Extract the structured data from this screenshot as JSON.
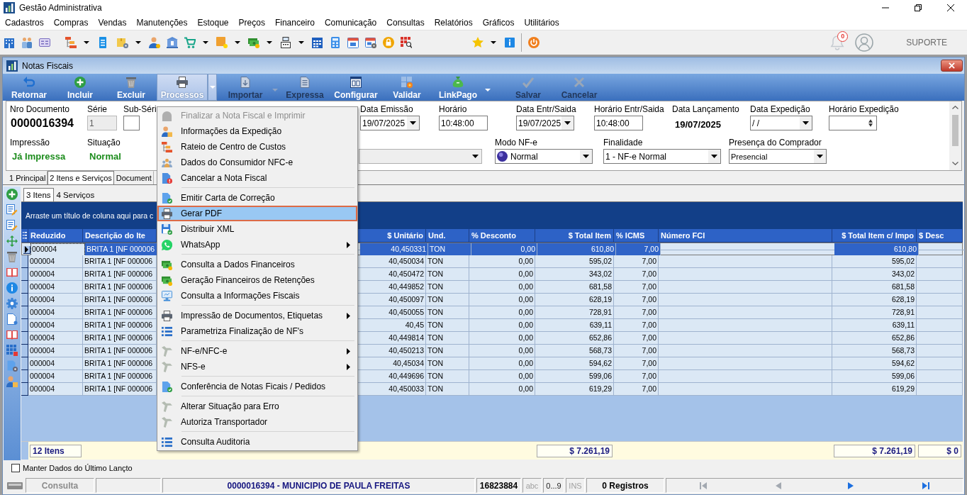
{
  "window": {
    "title": "Gestão Administrativa"
  },
  "menu_bar": [
    "Cadastros",
    "Compras",
    "Vendas",
    "Manutenções",
    "Estoque",
    "Preços",
    "Financeiro",
    "Comunicação",
    "Consultas",
    "Relatórios",
    "Gráficos",
    "Utilitários"
  ],
  "toolbar": {
    "notification_count": "0",
    "user": "SUPORTE"
  },
  "document_window": {
    "title": "Notas Fiscais"
  },
  "actions": [
    {
      "label": "Retornar",
      "selected": false,
      "disabled": false,
      "dropdown": false
    },
    {
      "label": "Incluir",
      "selected": false,
      "disabled": false,
      "dropdown": false
    },
    {
      "label": "Excluir",
      "selected": false,
      "disabled": false,
      "dropdown": false
    },
    {
      "label": "Processos",
      "selected": true,
      "disabled": false,
      "dropdown": true
    },
    {
      "label": "Importar",
      "selected": false,
      "disabled": true,
      "dropdown": true
    },
    {
      "label": "Expressa",
      "selected": false,
      "disabled": true,
      "dropdown": false
    },
    {
      "label": "Configurar",
      "selected": false,
      "disabled": false,
      "dropdown": false
    },
    {
      "label": "Validar",
      "selected": false,
      "disabled": false,
      "dropdown": false
    },
    {
      "label": "LinkPago",
      "selected": false,
      "disabled": false,
      "dropdown": true
    },
    {
      "label": "Salvar",
      "selected": false,
      "disabled": true,
      "dropdown": false
    },
    {
      "label": "Cancelar",
      "selected": false,
      "disabled": true,
      "dropdown": false
    }
  ],
  "form": {
    "row_1": [
      {
        "kind": "display",
        "label": "Nro Documento",
        "value": "0000016394",
        "disabled": false
      },
      {
        "kind": "input",
        "label": "Série",
        "value": "1",
        "disabled": true
      },
      {
        "kind": "input",
        "label": "Sub-Séri",
        "disabled": false
      },
      {
        "kind": "select",
        "label": "Data Emissão",
        "value": "19/07/2025",
        "disabled": false
      },
      {
        "kind": "input",
        "label": "Horário",
        "value": "10:48:00",
        "disabled": false
      },
      {
        "kind": "select",
        "label": "Data Entr/Saida",
        "value": "19/07/2025",
        "disabled": false
      },
      {
        "kind": "input",
        "label": "Horário Entr/Saida",
        "value": "10:48:00",
        "disabled": false
      },
      {
        "kind": "date",
        "label": "Data Lançamento",
        "value": "19/07/2025",
        "disabled": false
      },
      {
        "kind": "select",
        "label": "Data Expedição",
        "value": "/ /",
        "disabled": false
      },
      {
        "kind": "spin",
        "label": "Horário Expedição",
        "disabled": false
      }
    ],
    "row_2": [
      {
        "kind": "status",
        "label": "Impressão",
        "value": "Já Impressa",
        "disabled": false
      },
      {
        "kind": "status",
        "label": "Situação",
        "value": "Normal",
        "disabled": false
      },
      {
        "kind": "select",
        "disabled": true
      },
      {
        "kind": "iconselect",
        "label": "Modo NF-e",
        "value": "Normal",
        "disabled": false
      },
      {
        "kind": "select",
        "label": "Finalidade",
        "value": "1 - NF-e Normal",
        "disabled": false
      },
      {
        "kind": "select",
        "label": "Presença do Comprador",
        "value": "Presencial",
        "disabled": false
      }
    ]
  },
  "tabs": [
    {
      "label": "1 Principal",
      "selected": false
    },
    {
      "label": "2 Itens e Serviços",
      "selected": true
    },
    {
      "label": "Document",
      "selected": false
    }
  ],
  "subtabs": [
    {
      "label": "3 Itens",
      "selected": true
    },
    {
      "label": "4 Serviços",
      "selected": false
    }
  ],
  "grid": {
    "group_hint": "Arraste um título de coluna aqui para c",
    "columns": [
      "Reduzido",
      "Descrição do Ite",
      "$ Unitário",
      "Und.",
      "% Desconto",
      "$ Total Item",
      "% ICMS",
      "Número FCI",
      "$ Total Item c/ Impo",
      "$ Desc"
    ],
    "rows": [
      {
        "selected": true,
        "code": "000004",
        "description": "BRITA 1 [NF 000006",
        "unit_price": "40,450331",
        "unit": "TON",
        "discount": "0,00",
        "total": "610,80",
        "icms": "7,00",
        "total_with_taxes": "610,80"
      },
      {
        "selected": false,
        "code": "000004",
        "description": "BRITA 1 [NF 000006",
        "unit_price": "40,450034",
        "unit": "TON",
        "discount": "0,00",
        "total": "595,02",
        "icms": "7,00",
        "total_with_taxes": "595,02"
      },
      {
        "selected": false,
        "code": "000004",
        "description": "BRITA 1 [NF 000006",
        "unit_price": "40,450472",
        "unit": "TON",
        "discount": "0,00",
        "total": "343,02",
        "icms": "7,00",
        "total_with_taxes": "343,02"
      },
      {
        "selected": false,
        "code": "000004",
        "description": "BRITA 1 [NF 000006",
        "unit_price": "40,449852",
        "unit": "TON",
        "discount": "0,00",
        "total": "681,58",
        "icms": "7,00",
        "total_with_taxes": "681,58"
      },
      {
        "selected": false,
        "code": "000004",
        "description": "BRITA 1 [NF 000006",
        "unit_price": "40,450097",
        "unit": "TON",
        "discount": "0,00",
        "total": "628,19",
        "icms": "7,00",
        "total_with_taxes": "628,19"
      },
      {
        "selected": false,
        "code": "000004",
        "description": "BRITA 1 [NF 000006",
        "unit_price": "40,450055",
        "unit": "TON",
        "discount": "0,00",
        "total": "728,91",
        "icms": "7,00",
        "total_with_taxes": "728,91"
      },
      {
        "selected": false,
        "code": "000004",
        "description": "BRITA 1 [NF 000006",
        "unit_price": "40,45",
        "unit": "TON",
        "discount": "0,00",
        "total": "639,11",
        "icms": "7,00",
        "total_with_taxes": "639,11"
      },
      {
        "selected": false,
        "code": "000004",
        "description": "BRITA 1 [NF 000006",
        "unit_price": "40,449814",
        "unit": "TON",
        "discount": "0,00",
        "total": "652,86",
        "icms": "7,00",
        "total_with_taxes": "652,86"
      },
      {
        "selected": false,
        "code": "000004",
        "description": "BRITA 1 [NF 000006",
        "unit_price": "40,450213",
        "unit": "TON",
        "discount": "0,00",
        "total": "568,73",
        "icms": "7,00",
        "total_with_taxes": "568,73"
      },
      {
        "selected": false,
        "code": "000004",
        "description": "BRITA 1 [NF 000006",
        "unit_price": "40,45034",
        "unit": "TON",
        "discount": "0,00",
        "total": "594,62",
        "icms": "7,00",
        "total_with_taxes": "594,62"
      },
      {
        "selected": false,
        "code": "000004",
        "description": "BRITA 1 [NF 000006",
        "unit_price": "40,449696",
        "unit": "TON",
        "discount": "0,00",
        "total": "599,06",
        "icms": "7,00",
        "total_with_taxes": "599,06"
      },
      {
        "selected": false,
        "code": "000004",
        "description": "BRITA 1 [NF 000006",
        "unit_price": "40,450033",
        "unit": "TON",
        "discount": "0,00",
        "total": "619,29",
        "icms": "7,00",
        "total_with_taxes": "619,29"
      }
    ],
    "footer": {
      "item_count": "12 Itens",
      "total": "$ 7.261,19",
      "total_with_taxes": "$ 7.261,19",
      "discount_value": "$ 0"
    }
  },
  "keep_data": {
    "label": "Manter Dados do Último Lançto",
    "checked": false
  },
  "status_bar": {
    "mode": "Consulta",
    "record": "0000016394 - MUNICIPIO DE PAULA FREITAS",
    "code": "16823884",
    "indicators": [
      {
        "label": "abc",
        "active": false
      },
      {
        "label": "0...9",
        "active": true
      },
      {
        "label": "INS",
        "active": false
      }
    ],
    "records": "0 Registros",
    "navigation": [
      {
        "kind": "first",
        "disabled": true
      },
      {
        "kind": "prev",
        "disabled": true
      },
      {
        "kind": "next",
        "disabled": false
      },
      {
        "kind": "last",
        "disabled": false
      }
    ]
  },
  "process_menu": {
    "groups": [
      {
        "items": [
          {
            "label": "Finalizar a Nota Fiscal e Imprimir",
            "selected": false,
            "disabled": true,
            "submenu": false
          },
          {
            "label": "Informações da Expedição",
            "selected": false,
            "disabled": false,
            "submenu": false
          },
          {
            "label": "Rateio de Centro de Custos",
            "selected": false,
            "disabled": false,
            "submenu": false
          },
          {
            "label": "Dados do Consumidor NFC-e",
            "selected": false,
            "disabled": false,
            "submenu": false
          },
          {
            "label": "Cancelar a Nota Fiscal",
            "selected": false,
            "disabled": false,
            "submenu": false
          }
        ]
      },
      {
        "items": [
          {
            "label": "Emitir Carta de Correção",
            "selected": false,
            "disabled": false,
            "submenu": false
          },
          {
            "label": "Gerar PDF",
            "selected": true,
            "disabled": false,
            "submenu": false
          },
          {
            "label": "Distribuir XML",
            "selected": false,
            "disabled": false,
            "submenu": false
          },
          {
            "label": "WhatsApp",
            "selected": false,
            "disabled": false,
            "submenu": true
          }
        ]
      },
      {
        "items": [
          {
            "label": "Consulta a Dados Financeiros",
            "selected": false,
            "disabled": false,
            "submenu": false
          },
          {
            "label": "Geração Financeiros de Retenções",
            "selected": false,
            "disabled": false,
            "submenu": false
          },
          {
            "label": "Consulta a Informações Fiscais",
            "selected": false,
            "disabled": false,
            "submenu": false
          }
        ]
      },
      {
        "items": [
          {
            "label": "Impressão de Documentos, Etiquetas",
            "selected": false,
            "disabled": false,
            "submenu": true
          },
          {
            "label": "Parametriza Finalização de NF's",
            "selected": false,
            "disabled": false,
            "submenu": false
          }
        ]
      },
      {
        "items": [
          {
            "label": "NF-e/NFC-e",
            "selected": false,
            "disabled": false,
            "submenu": true
          },
          {
            "label": "NFS-e",
            "selected": false,
            "disabled": false,
            "submenu": true
          }
        ]
      },
      {
        "items": [
          {
            "label": "Conferência de Notas Ficais / Pedidos",
            "selected": false,
            "disabled": false,
            "submenu": false
          }
        ]
      },
      {
        "items": [
          {
            "label": "Alterar Situação para Erro",
            "selected": false,
            "disabled": false,
            "submenu": false
          },
          {
            "label": "Autoriza Transportador",
            "selected": false,
            "disabled": false,
            "submenu": false
          }
        ]
      },
      {
        "items": [
          {
            "label": "Consulta Auditoria",
            "selected": false,
            "disabled": false,
            "submenu": false
          }
        ]
      }
    ]
  }
}
